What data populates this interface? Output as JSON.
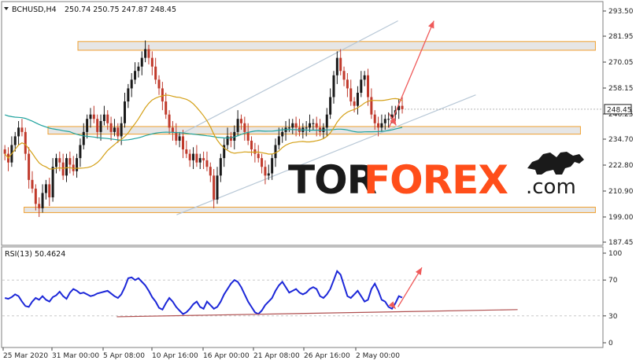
{
  "header": {
    "symbol": "BCHUSD,H4",
    "ohlc": "250.74 250.75 247.87 248.45"
  },
  "rsi_header": "RSI(13) 50.4624",
  "watermark": {
    "brand_dark": "TOR",
    "brand_accent": "FOREX",
    "domain_suffix": ".com"
  },
  "colors": {
    "bullish_candle": "#1a1a1a",
    "bearish_candle": "#c0392b",
    "ma_long": "#20a39e",
    "ma_short": "#d4a017",
    "zone_fill": "#e6e6e6",
    "zone_border": "#f0a030",
    "channel_line": "#b7c7d6",
    "forecast_arrow": "#ef5a5a",
    "rsi_line": "#1c27d8",
    "rsi_trend": "#b05050",
    "watermark_dark": "#1a1a1a",
    "watermark_accent": "#ff4e1a",
    "price_badge": "#ffffff"
  },
  "chart_data": [
    {
      "type": "candlestick",
      "symbol": "BCHUSD",
      "timeframe": "H4",
      "ylim": [
        187.45,
        293.5
      ],
      "y_ticks": [
        "293.50",
        "281.95",
        "270.05",
        "258.15",
        "246.25",
        "234.70",
        "222.80",
        "210.90",
        "199.00",
        "187.45"
      ],
      "x_ticks": [
        "25 Mar 2020",
        "31 Mar 00:00",
        "5 Apr 08:00",
        "10 Apr 16:00",
        "16 Apr 00:00",
        "21 Apr 08:00",
        "26 Apr 16:00",
        "2 May 00:00"
      ],
      "last_price": "248.45",
      "series_close": [
        228,
        224,
        232,
        236,
        240,
        238,
        228,
        216,
        212,
        205,
        203,
        210,
        214,
        208,
        222,
        226,
        224,
        218,
        226,
        223,
        220,
        226,
        232,
        238,
        244,
        246,
        244,
        238,
        243,
        246,
        242,
        238,
        240,
        236,
        242,
        252,
        258,
        262,
        266,
        268,
        272,
        276,
        272,
        268,
        262,
        258,
        252,
        246,
        240,
        238,
        234,
        236,
        230,
        228,
        225,
        228,
        224,
        226,
        225,
        222,
        218,
        207,
        218,
        226,
        232,
        236,
        234,
        238,
        244,
        242,
        238,
        234,
        230,
        228,
        226,
        222,
        218,
        219,
        226,
        232,
        236,
        238,
        240,
        240,
        242,
        240,
        238,
        240,
        240,
        242,
        242,
        240,
        238,
        240,
        246,
        254,
        264,
        272,
        266,
        262,
        258,
        252,
        250,
        256,
        262,
        264,
        254,
        246,
        242,
        240,
        242,
        244,
        244,
        246,
        248,
        250,
        248.45
      ],
      "zones": [
        {
          "low": 275.5,
          "high": 279.5
        },
        {
          "low": 237.0,
          "high": 240.5
        },
        {
          "low": 201.0,
          "high": 203.5
        }
      ],
      "channel": [
        {
          "from": [
            0.29,
            236
          ],
          "to": [
            0.66,
            289
          ]
        },
        {
          "from": [
            0.29,
            200
          ],
          "to": [
            0.79,
            255
          ]
        }
      ],
      "forecast": [
        {
          "from": [
            0.645,
            240
          ],
          "to": [
            0.72,
            289
          ]
        },
        {
          "from": [
            0.645,
            246.5
          ],
          "to": [
            0.657,
            241
          ]
        }
      ]
    },
    {
      "type": "line",
      "name": "RSI(13)",
      "ylim": [
        0,
        100
      ],
      "y_ticks": [
        "100",
        "70",
        "30",
        "0"
      ],
      "levels": [
        70,
        30
      ],
      "last_value": "50.4624",
      "values": [
        50,
        49,
        51,
        54,
        52,
        46,
        41,
        40,
        46,
        50,
        48,
        52,
        48,
        46,
        51,
        53,
        57,
        52,
        49,
        56,
        60,
        58,
        55,
        56,
        54,
        52,
        53,
        55,
        56,
        57,
        58,
        55,
        52,
        50,
        54,
        62,
        72,
        73,
        70,
        72,
        68,
        64,
        58,
        51,
        46,
        39,
        37,
        44,
        50,
        46,
        40,
        36,
        32,
        34,
        38,
        43,
        46,
        40,
        38,
        46,
        42,
        38,
        40,
        46,
        54,
        60,
        66,
        70,
        68,
        62,
        54,
        46,
        40,
        34,
        32,
        36,
        42,
        46,
        50,
        58,
        64,
        68,
        62,
        56,
        58,
        60,
        56,
        54,
        56,
        60,
        62,
        60,
        52,
        50,
        54,
        60,
        70,
        80,
        76,
        64,
        52,
        50,
        54,
        58,
        52,
        46,
        48,
        60,
        66,
        58,
        48,
        46,
        40,
        38,
        44,
        52,
        50.46
      ],
      "trendline": {
        "from": [
          0.19,
          29
        ],
        "to": [
          0.86,
          37
        ]
      },
      "forecast": [
        {
          "from": [
            0.66,
            40
          ],
          "to": [
            0.7,
            84
          ]
        },
        {
          "from": [
            0.648,
            44
          ],
          "to": [
            0.656,
            38
          ]
        }
      ]
    }
  ]
}
